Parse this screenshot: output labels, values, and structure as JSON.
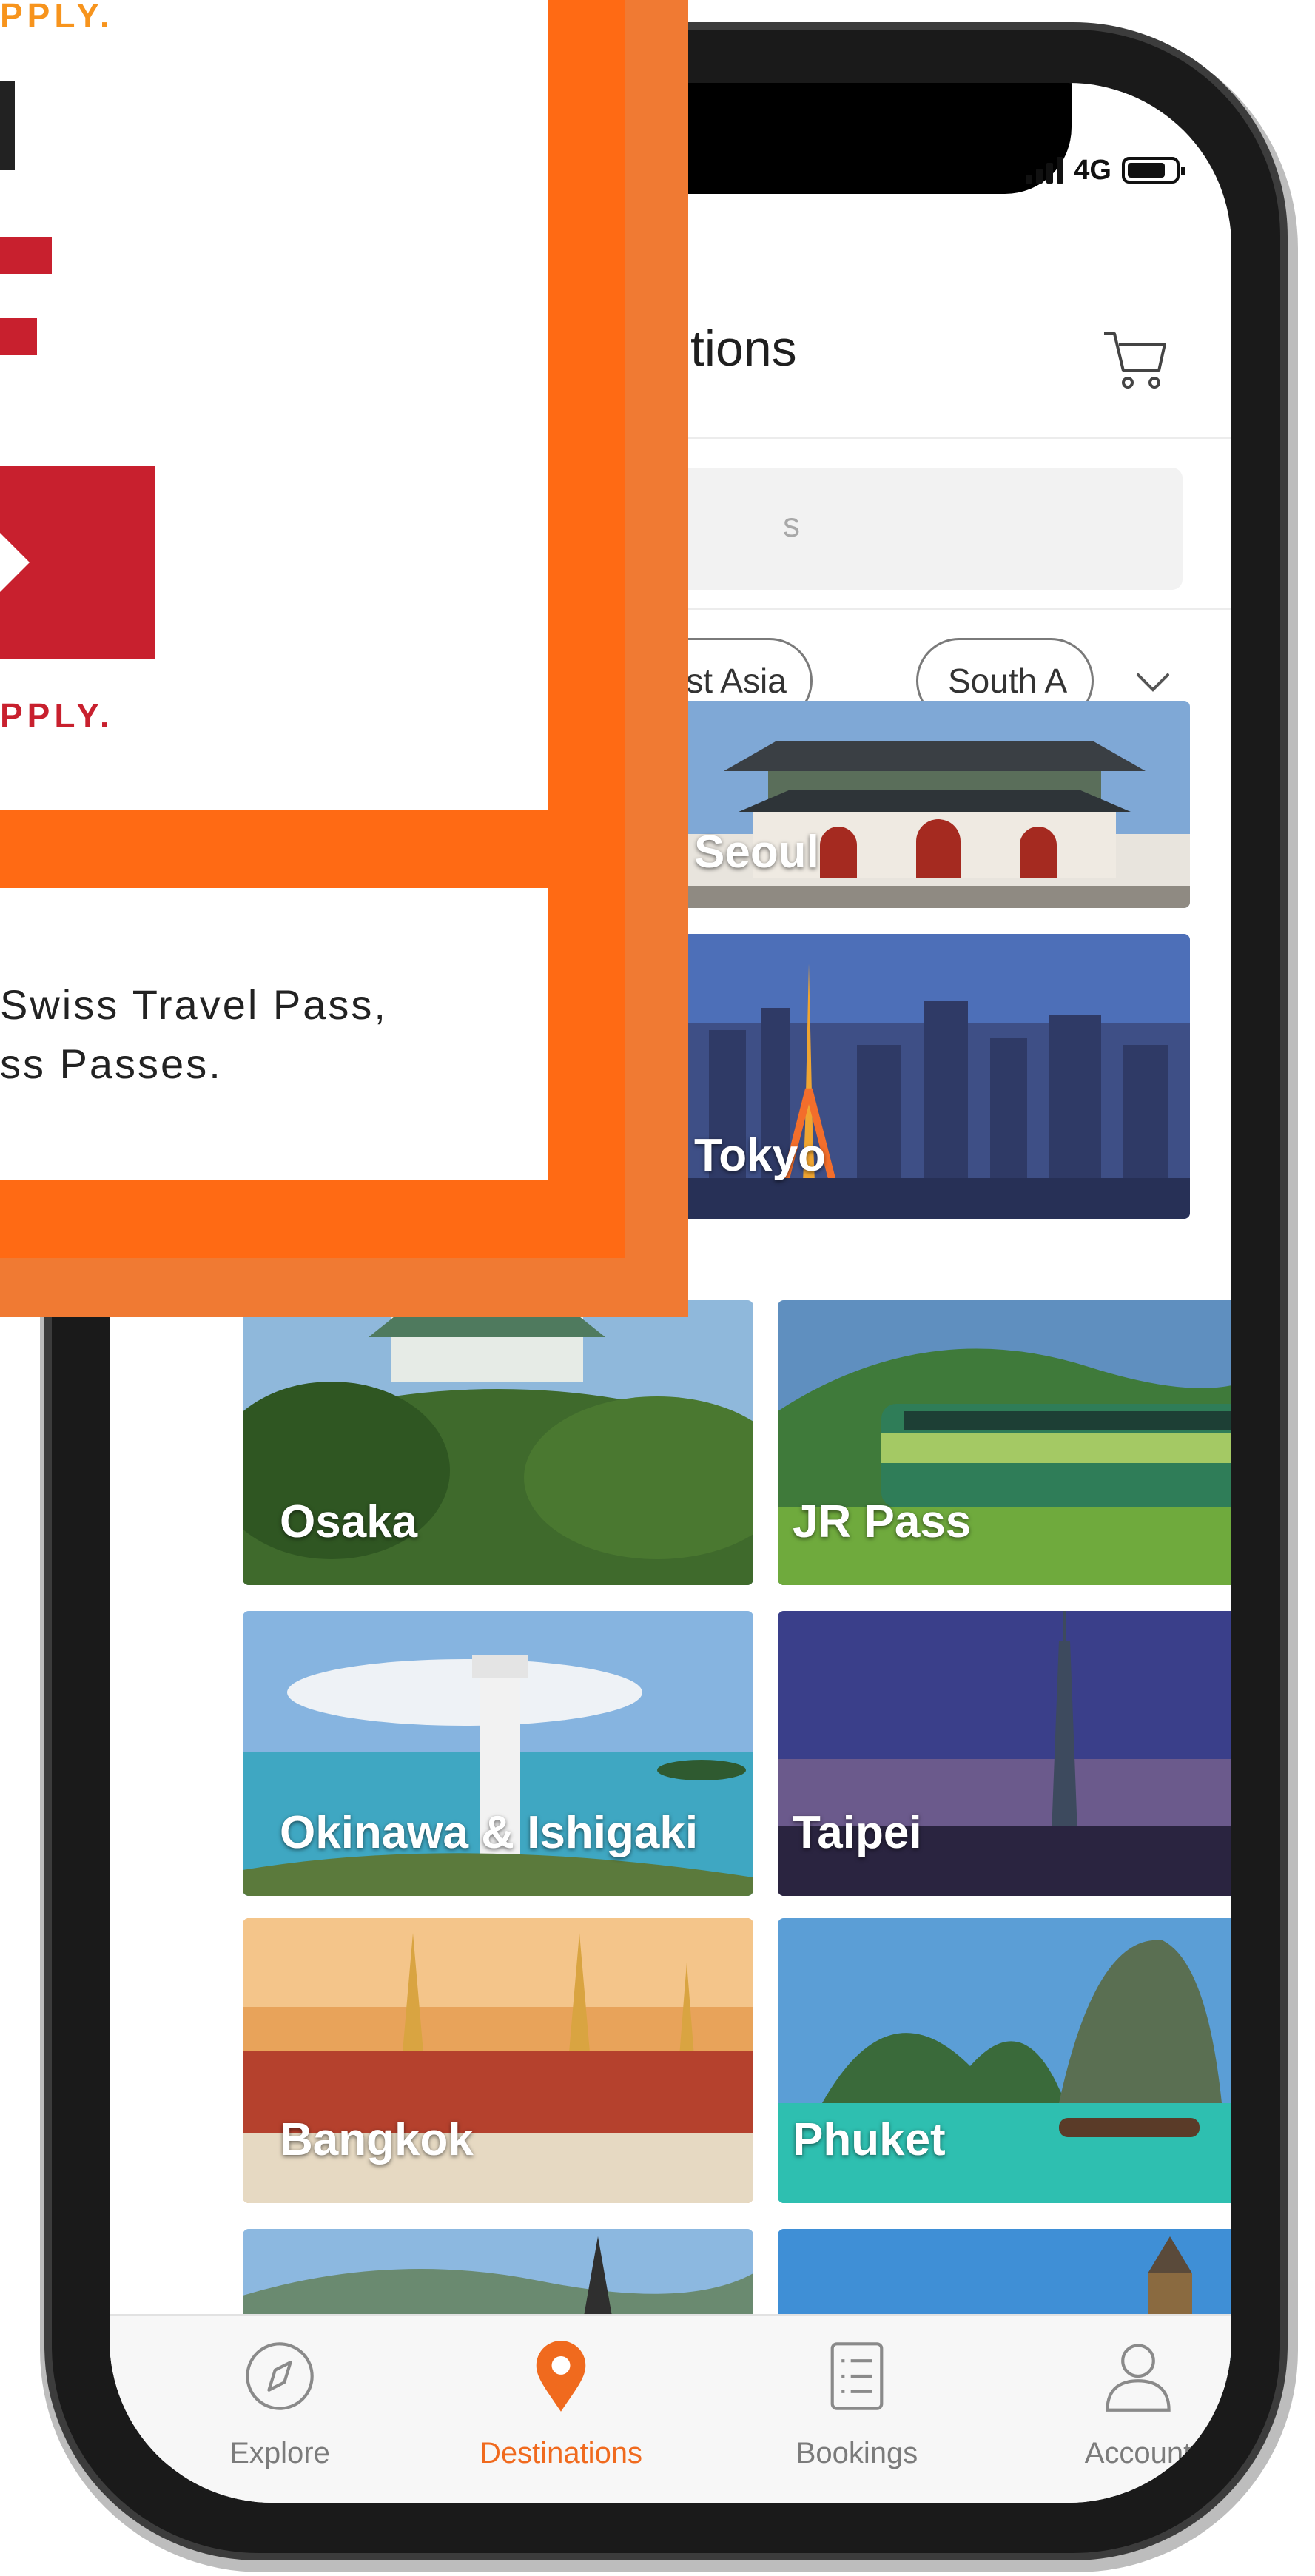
{
  "status_bar": {
    "network": "4G"
  },
  "header": {
    "title_visible": "tions",
    "cart_icon": "cart-icon"
  },
  "search": {
    "placeholder_visible": "s"
  },
  "chips": [
    {
      "label": "East Asia"
    },
    {
      "label": "South A"
    }
  ],
  "destinations": [
    {
      "label": "Seoul"
    },
    {
      "label": "Tokyo"
    },
    {
      "label": "Osaka"
    },
    {
      "label": "JR Pass"
    },
    {
      "label": "Okinawa & Ishigaki"
    },
    {
      "label": "Taipei"
    },
    {
      "label": "Bangkok"
    },
    {
      "label": "Phuket"
    },
    {
      "label": ""
    },
    {
      "label": ""
    }
  ],
  "tabbar": {
    "active": "Destinations",
    "items": [
      {
        "label": "Explore",
        "icon": "compass-icon"
      },
      {
        "label": "Destinations",
        "icon": "map-pin-icon"
      },
      {
        "label": "Bookings",
        "icon": "list-icon"
      },
      {
        "label": "Account",
        "icon": "user-icon"
      }
    ]
  },
  "promo": {
    "tagline_top": "PPLY.",
    "tagline_mid": "PPLY.",
    "line1": "Swiss Travel Pass,",
    "line2": "ss Passes."
  },
  "colors": {
    "accent": "#f06a1e",
    "promo_orange": "#ff6a14",
    "logo_red": "#c8202e"
  }
}
